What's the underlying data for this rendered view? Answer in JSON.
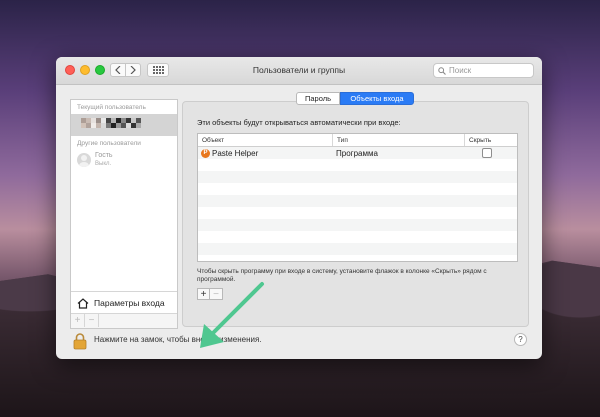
{
  "window": {
    "title": "Пользователи и группы",
    "search_placeholder": "Поиск"
  },
  "sidebar": {
    "current_user_section": "Текущий пользователь",
    "other_users_section": "Другие пользователи",
    "guest_name": "Гость",
    "guest_status": "Выкл.",
    "login_options": "Параметры входа",
    "add_label": "+",
    "remove_label": "−"
  },
  "tabs": [
    {
      "label": "Пароль",
      "active": false
    },
    {
      "label": "Объекты входа",
      "active": true
    }
  ],
  "main": {
    "heading": "Эти объекты будут открываться автоматически при входе:",
    "columns": [
      "Объект",
      "Тип",
      "Скрыть"
    ],
    "rows": [
      {
        "object": "Paste Helper",
        "type": "Программа",
        "hide": false,
        "icon": "paste-helper-app-icon",
        "icon_letter": "P"
      }
    ],
    "hint": "Чтобы скрыть программу при входе в систему, установите флажок в колонке «Скрыть» рядом с программой.",
    "add_label": "+",
    "remove_label": "−"
  },
  "footer": {
    "lock_text": "Нажмите на замок, чтобы внести изменения.",
    "help_label": "?"
  },
  "colors": {
    "accent": "#2a7bf5",
    "annotation_arrow": "#4fc790",
    "app_icon": "#e8771e"
  }
}
